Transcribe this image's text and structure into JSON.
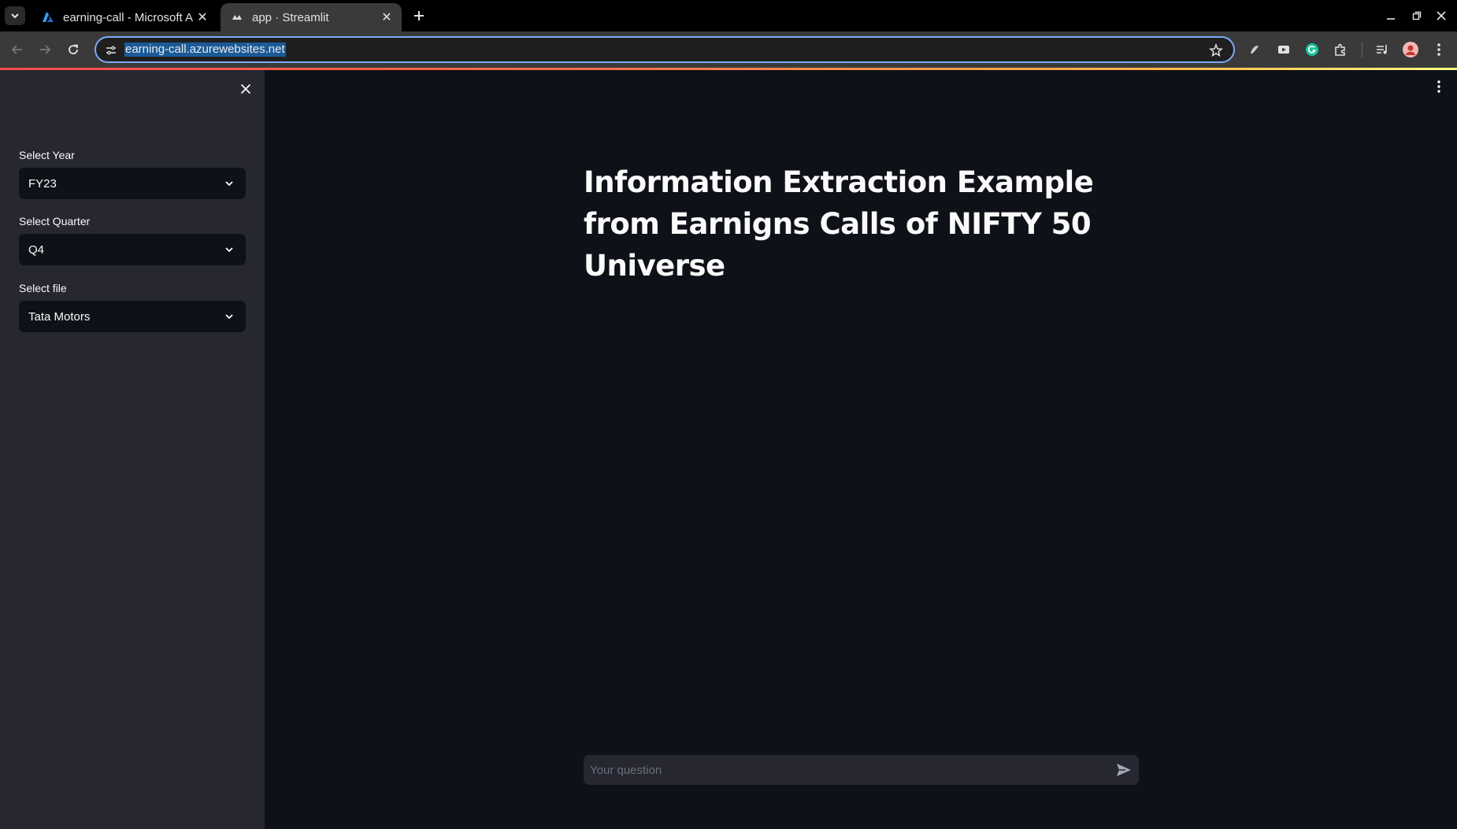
{
  "browser": {
    "tabs": [
      {
        "title": "earning-call - Microsoft A",
        "active": false,
        "icon": "azure-icon"
      },
      {
        "title": "app · Streamlit",
        "active": true,
        "icon": "streamlit-icon"
      }
    ],
    "url": "earning-call.azurewebsites.net"
  },
  "sidebar": {
    "year": {
      "label": "Select Year",
      "value": "FY23"
    },
    "quarter": {
      "label": "Select Quarter",
      "value": "Q4"
    },
    "file": {
      "label": "Select file",
      "value": "Tata Motors"
    }
  },
  "main": {
    "title": "Information Extraction Example from Earnigns Calls of NIFTY 50 Universe",
    "chat_placeholder": "Your question"
  },
  "colors": {
    "background": "#0e1117",
    "sidebar": "#262730",
    "text": "#fafafa",
    "accent": "#ff4b4b"
  }
}
